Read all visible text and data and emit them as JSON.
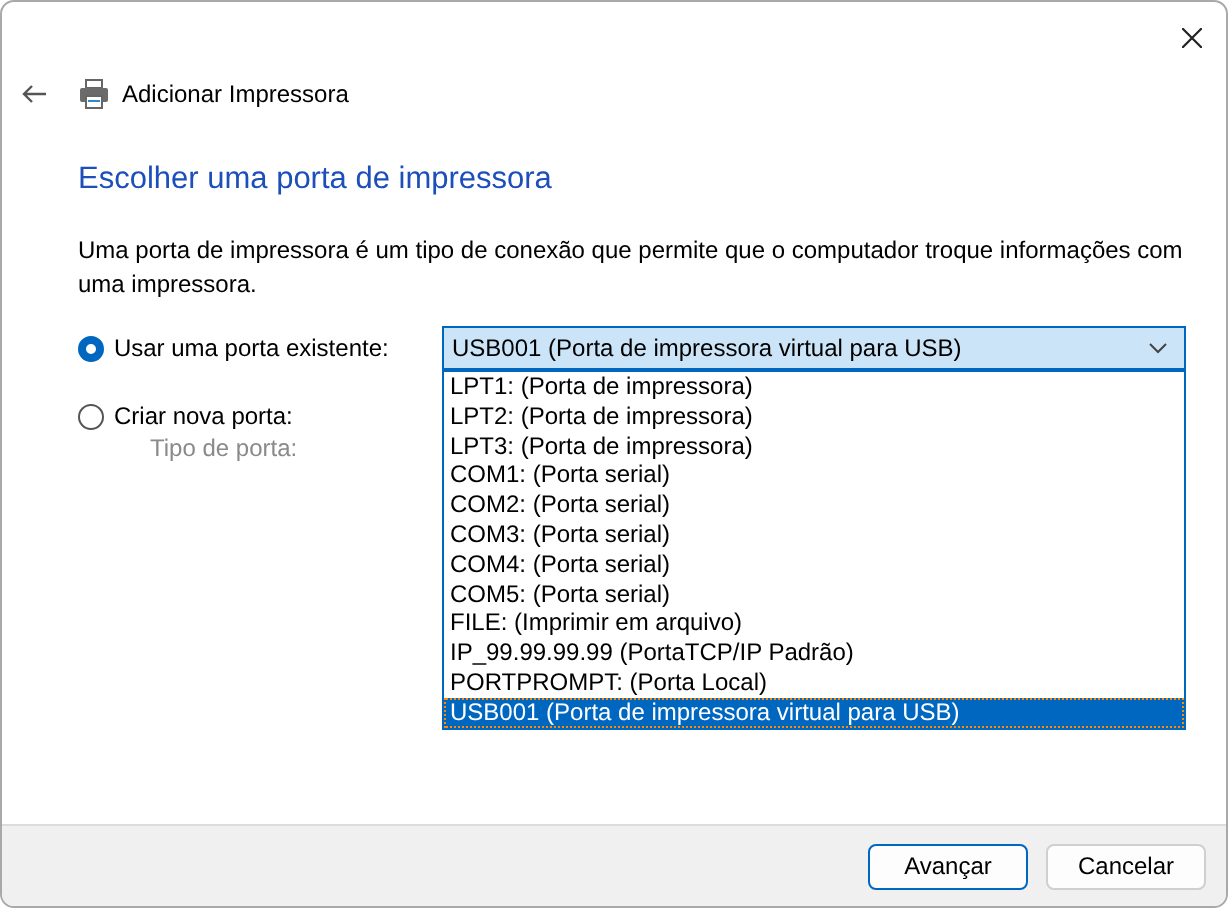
{
  "window": {
    "title": "Adicionar Impressora"
  },
  "heading": "Escolher uma porta de impressora",
  "description": "Uma porta de impressora é um tipo de conexão que permite que o computador troque informações com uma impressora.",
  "options": [
    {
      "label": "Usar uma porta existente:",
      "selected": true
    },
    {
      "label": "Criar nova porta:",
      "selected": false
    }
  ],
  "port_combo": {
    "value": "USB001 (Porta de impressora virtual para USB)",
    "expanded": true,
    "items": [
      {
        "label": "LPT1: (Porta de impressora)",
        "selected": false
      },
      {
        "label": "LPT2: (Porta de impressora)",
        "selected": false
      },
      {
        "label": "LPT3: (Porta de impressora)",
        "selected": false
      },
      {
        "label": "COM1: (Porta serial)",
        "selected": false
      },
      {
        "label": "COM2: (Porta serial)",
        "selected": false
      },
      {
        "label": "COM3: (Porta serial)",
        "selected": false
      },
      {
        "label": "COM4: (Porta serial)",
        "selected": false
      },
      {
        "label": "COM5: (Porta serial)",
        "selected": false
      },
      {
        "label": "FILE: (Imprimir em arquivo)",
        "selected": false
      },
      {
        "label": "IP_99.99.99.99 (PortaTCP/IP Padrão)",
        "selected": false
      },
      {
        "label": "PORTPROMPT: (Porta Local)",
        "selected": false
      },
      {
        "label": "USB001 (Porta de impressora virtual para USB)",
        "selected": true
      }
    ]
  },
  "port_type": {
    "label": "Tipo de porta:",
    "disabled": true
  },
  "buttons": [
    {
      "label": "Avançar",
      "default": true
    },
    {
      "label": "Cancelar",
      "default": false
    }
  ]
}
